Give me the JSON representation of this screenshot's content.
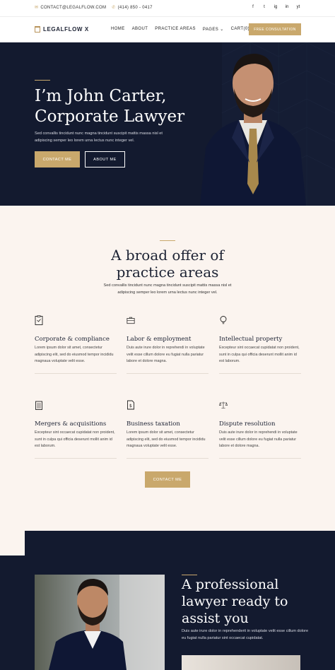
{
  "topbar": {
    "email": "CONTACT@LEGALFLOW.COM",
    "phone": "(414) 850 - 0417",
    "social": [
      "f",
      "t",
      "ig",
      "in",
      "yt"
    ]
  },
  "nav": {
    "logo": "LEGALFLOW X",
    "items": [
      "HOME",
      "ABOUT",
      "PRACTICE AREAS",
      "PAGES",
      "CART(0)"
    ],
    "cta": "FREE CONSULTATION"
  },
  "hero": {
    "title_line1": "I’m John Carter,",
    "title_line2": "Corporate Lawyer",
    "text": "Sed convallis tincidunt nunc magna tincidunt suscipit mattis massa nisl et adipiscing semper leo lorem urna lectus nunc integer vel.",
    "btn_primary": "CONTACT ME",
    "btn_secondary": "ABOUT ME"
  },
  "practice": {
    "title_line1": "A broad offer of",
    "title_line2": "practice areas",
    "lead": "Sed convallis tincidunt nunc magna tincidunt suscipit mattis massa nisl et adipiscing semper leo lorem urna lectus nunc integer vel.",
    "cards": [
      {
        "title": "Corporate & compliance",
        "text": "Lorem ipsum dolor sit amet, consectetur adipiscing elit, sed do eiusmod tempor incididu magnaua voluptate velit esse."
      },
      {
        "title": "Labor & employment",
        "text": "Duis aute irure dolor in reprehendi in voluptate velit esse cillum dolore eu fugiat nulla pariatur labore et dolore magna."
      },
      {
        "title": "Intellectual property",
        "text": "Excepteur sint occaecat cupidatat non proident, sunt in culpa qui officia deserunt mollit anim id est laborum."
      },
      {
        "title": "Mergers & acquisitions",
        "text": "Excepteur sint occaecat cupidatat non proident, sunt in culpa qui officia deserunt mollit anim id est laborum."
      },
      {
        "title": "Business taxation",
        "text": "Lorem ipsum dolor sit amet, consectetur adipiscing elit, sed do eiusmod tempor incididu magnaua voluptate velit esse."
      },
      {
        "title": "Dispute resolution",
        "text": "Duis aute irure dolor in reprehendi in voluptate velit esse cillum dolore eu fugiat nulla pariatur labore et dolore magna."
      }
    ],
    "cta": "CONTACT ME"
  },
  "about": {
    "title_line1": "A professional",
    "title_line2": "lawyer ready to",
    "title_line3": "assist you",
    "text": "Duis aute irure dolor in reprehenderit in voluptate velit esse cillum dolore eu fugiat nulla pariatur sint occaecat cupidatat."
  },
  "colors": {
    "navy": "#131a2f",
    "gold": "#c9a86c",
    "cream": "#fbf4ef"
  }
}
